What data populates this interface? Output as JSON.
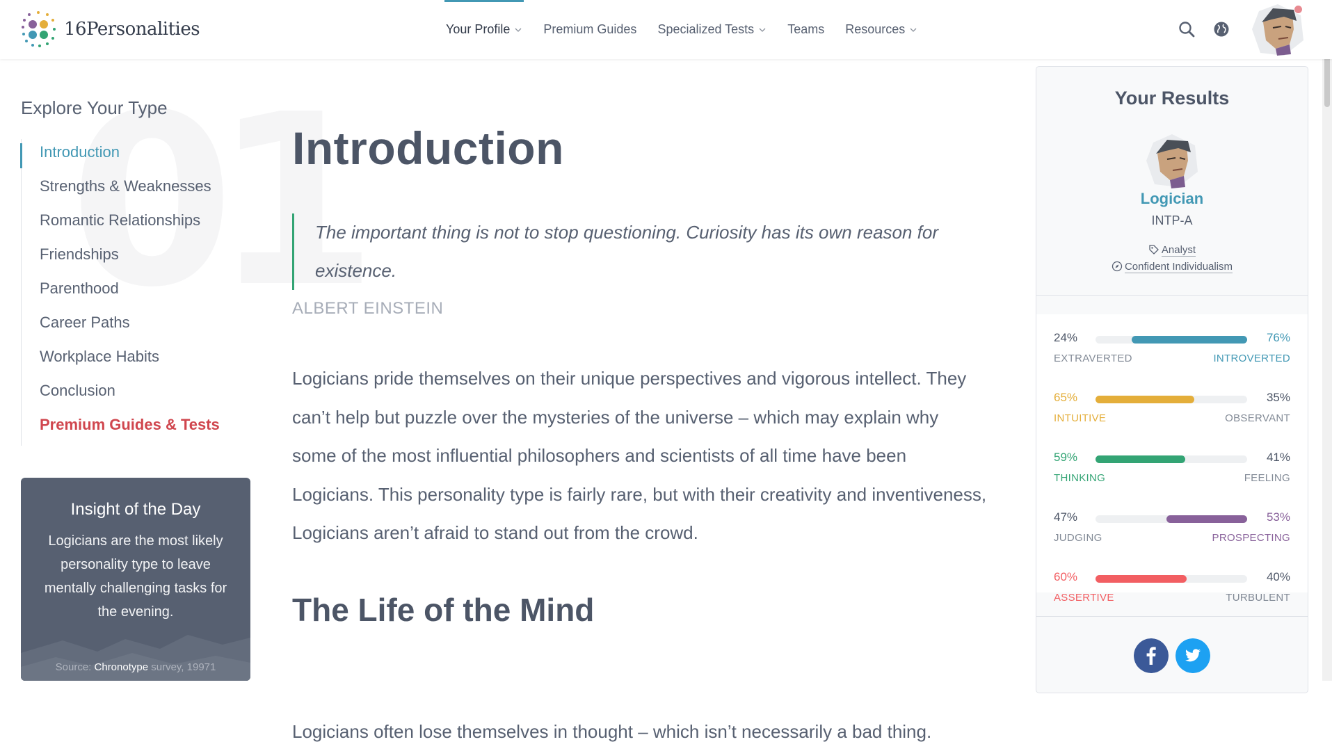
{
  "brand": {
    "name": "16Personalities"
  },
  "nav": [
    {
      "label": "Your Profile",
      "dropdown": true,
      "active": true
    },
    {
      "label": "Premium Guides",
      "dropdown": false
    },
    {
      "label": "Specialized Tests",
      "dropdown": true
    },
    {
      "label": "Teams",
      "dropdown": false
    },
    {
      "label": "Resources",
      "dropdown": true
    }
  ],
  "header_icons": [
    "search-icon",
    "globe-icon",
    "user-avatar"
  ],
  "sidebar": {
    "title": "Explore Your Type",
    "watermark": "01",
    "items": [
      {
        "label": "Introduction",
        "active": true
      },
      {
        "label": "Strengths & Weaknesses"
      },
      {
        "label": "Romantic Relationships"
      },
      {
        "label": "Friendships"
      },
      {
        "label": "Parenthood"
      },
      {
        "label": "Career Paths"
      },
      {
        "label": "Workplace Habits"
      },
      {
        "label": "Conclusion"
      },
      {
        "label": "Premium Guides & Tests",
        "premium": true
      }
    ]
  },
  "insight": {
    "title": "Insight of the Day",
    "text": "Logicians are the most likely personality type to leave mentally challenging tasks for the evening.",
    "source_prefix": "Source: ",
    "source_link": "Chronotype",
    "source_suffix": " survey, 19971"
  },
  "main": {
    "heading": "Introduction",
    "quote": "The important thing is not to stop questioning. Curiosity has its own reason for existence.",
    "quote_author": "ALBERT EINSTEIN",
    "paragraph": "Logicians pride themselves on their unique perspectives and vigorous intellect. They can’t help but puzzle over the mysteries of the universe – which may explain why some of the most influential philosophers and scientists of all time have been Logicians. This personality type is fairly rare, but with their creativity and inventiveness, Logicians aren’t afraid to stand out from the crowd.",
    "heading2": "The Life of the Mind",
    "paragraph2": "Logicians often lose themselves in thought – which isn’t necessarily a bad thing."
  },
  "results": {
    "title": "Your Results",
    "type_name": "Logician",
    "type_code": "INTP-A",
    "role": "Analyst",
    "strategy": "Confident Individualism",
    "traits": [
      {
        "left_pct": "24%",
        "right_pct": "76%",
        "left_label": "EXTRAVERTED",
        "right_label": "INTROVERTED",
        "value": 76,
        "side": "right",
        "color": "#4298b4"
      },
      {
        "left_pct": "65%",
        "right_pct": "35%",
        "left_label": "INTUITIVE",
        "right_label": "OBSERVANT",
        "value": 65,
        "side": "left",
        "color": "#e4ae3a"
      },
      {
        "left_pct": "59%",
        "right_pct": "41%",
        "left_label": "THINKING",
        "right_label": "FEELING",
        "value": 59,
        "side": "left",
        "color": "#33a474"
      },
      {
        "left_pct": "47%",
        "right_pct": "53%",
        "left_label": "JUDGING",
        "right_label": "PROSPECTING",
        "value": 53,
        "side": "right",
        "color": "#88619a"
      },
      {
        "left_pct": "60%",
        "right_pct": "40%",
        "left_label": "ASSERTIVE",
        "right_label": "TURBULENT",
        "value": 60,
        "side": "left",
        "color": "#f25e62"
      }
    ],
    "share": [
      "facebook-icon",
      "twitter-icon"
    ]
  },
  "colors": {
    "accent": "#4298b4",
    "premium": "#d0464e",
    "text": "#576071",
    "insight_bg": "#576071"
  }
}
